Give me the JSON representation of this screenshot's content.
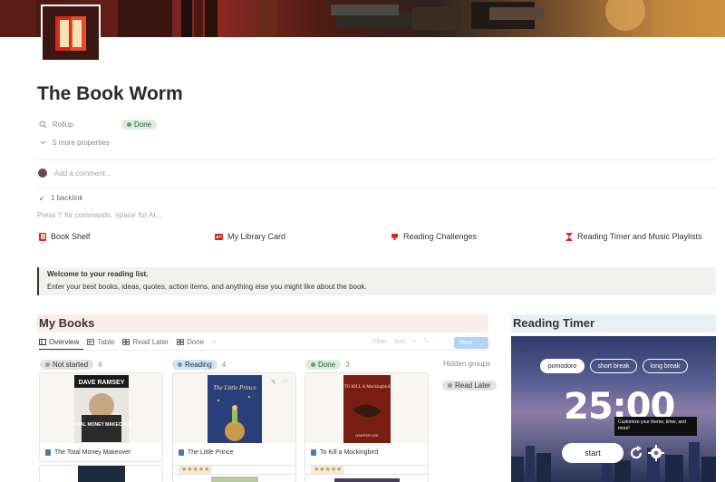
{
  "page": {
    "title": "The Book Worm",
    "properties": {
      "rollup_label": "Rollup",
      "rollup_value": "Done",
      "more_properties": "5 more properties"
    },
    "comment_placeholder": "Add a comment...",
    "backlink": "1 backlink",
    "command_hint": "Press '/' for commands, 'space' for AI..."
  },
  "nav_links": [
    {
      "label": "Book Shelf",
      "icon": "book-icon"
    },
    {
      "label": "My Library Card",
      "icon": "id-card-icon"
    },
    {
      "label": "Reading Challenges",
      "icon": "trophy-icon"
    },
    {
      "label": "Reading Timer and Music Playlists",
      "icon": "hourglass-icon"
    }
  ],
  "callout": {
    "heading": "Welcome to your reading list.",
    "body": "Enter your best books, ideas, quotes, action items, and anything else you might like about the book."
  },
  "my_books": {
    "heading": "My Books",
    "views": [
      "Overview",
      "Table",
      "Read Later",
      "Done"
    ],
    "tools": [
      "Filter",
      "Sort"
    ],
    "new_label": "New",
    "hidden_groups": "Hidden groups",
    "groups": [
      {
        "label": "Not started",
        "count": "4"
      },
      {
        "label": "Reading",
        "count": "4"
      },
      {
        "label": "Done",
        "count": "3"
      }
    ],
    "hidden_group_item": "Read Later",
    "cards": [
      {
        "title": "The Total Money Makeover",
        "cover_text": "DAVE RAMSEY",
        "cover_sub": "TOTAL MONEY MAKEOVER",
        "rating": ""
      },
      {
        "title": "The Little Prince",
        "cover_text": "The Little Prince",
        "cover_sub": "",
        "rating": "★★★★★"
      },
      {
        "title": "To Kill a Mockingbird",
        "cover_text": "TO KILL A Mockingbird",
        "cover_sub": "HARPER LEE",
        "rating": "★★★★★"
      }
    ]
  },
  "reading_timer": {
    "heading": "Reading Timer",
    "modes": [
      "pomodoro",
      "short break",
      "long break"
    ],
    "time": "25:00",
    "tooltip": "Customize your theme, timer, and more!",
    "start_label": "start"
  },
  "colors": {
    "accent_blue": "#2383e2",
    "done_green": "#dbeddb",
    "my_books_bg": "#fbecec",
    "timer_head_bg": "#e7f0f7"
  }
}
